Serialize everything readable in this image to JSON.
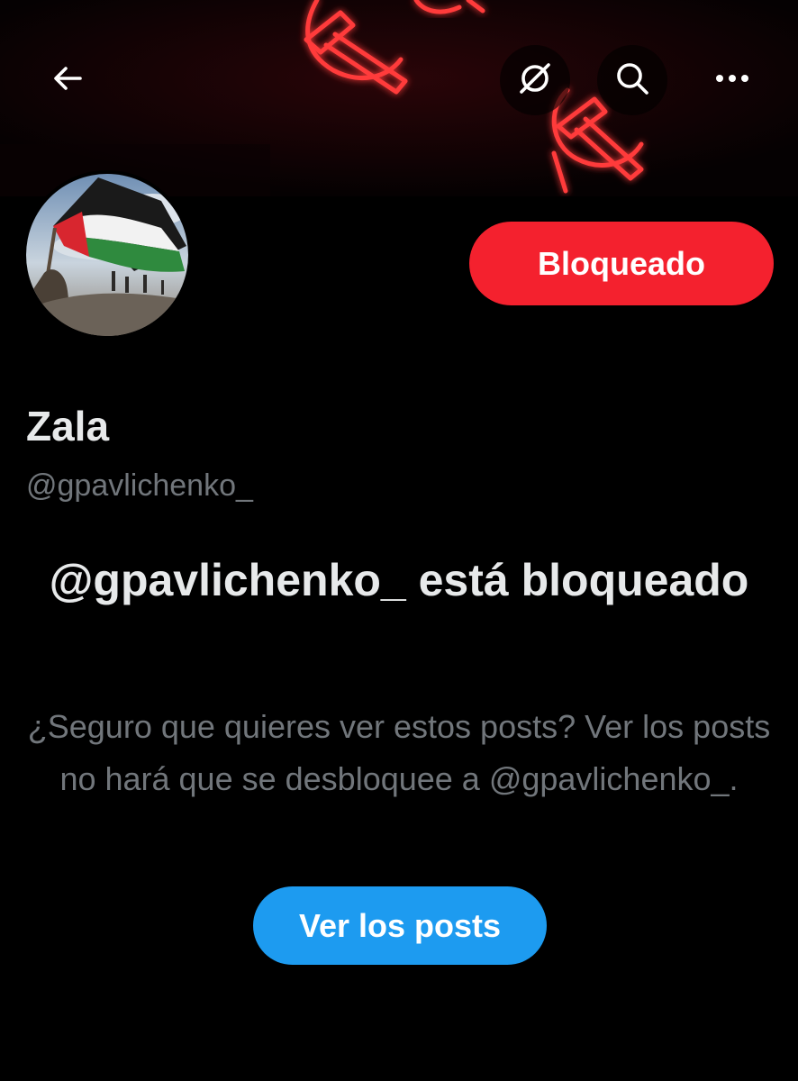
{
  "header": {
    "back_icon": "arrow-left-icon",
    "grok_icon": "grok-icon",
    "search_icon": "search-icon",
    "more_icon": "more-horizontal-icon"
  },
  "banner": {
    "description_icon": "neon-hammer-sickle-banner"
  },
  "profile": {
    "name": "Zala",
    "handle": "@gpavlichenko_",
    "avatar_icon": "palestinian-flag-avatar"
  },
  "actions": {
    "blocked_label": "Bloqueado",
    "blocked_color": "#f4212e"
  },
  "blocked_notice": {
    "title": "@gpavlichenko_ está bloqueado",
    "body": "¿Seguro que quieres ver estos posts? Ver los posts no hará que se desbloquee a @gpavlichenko_.",
    "view_button": "Ver los posts",
    "view_button_color": "#1d9bf0"
  }
}
